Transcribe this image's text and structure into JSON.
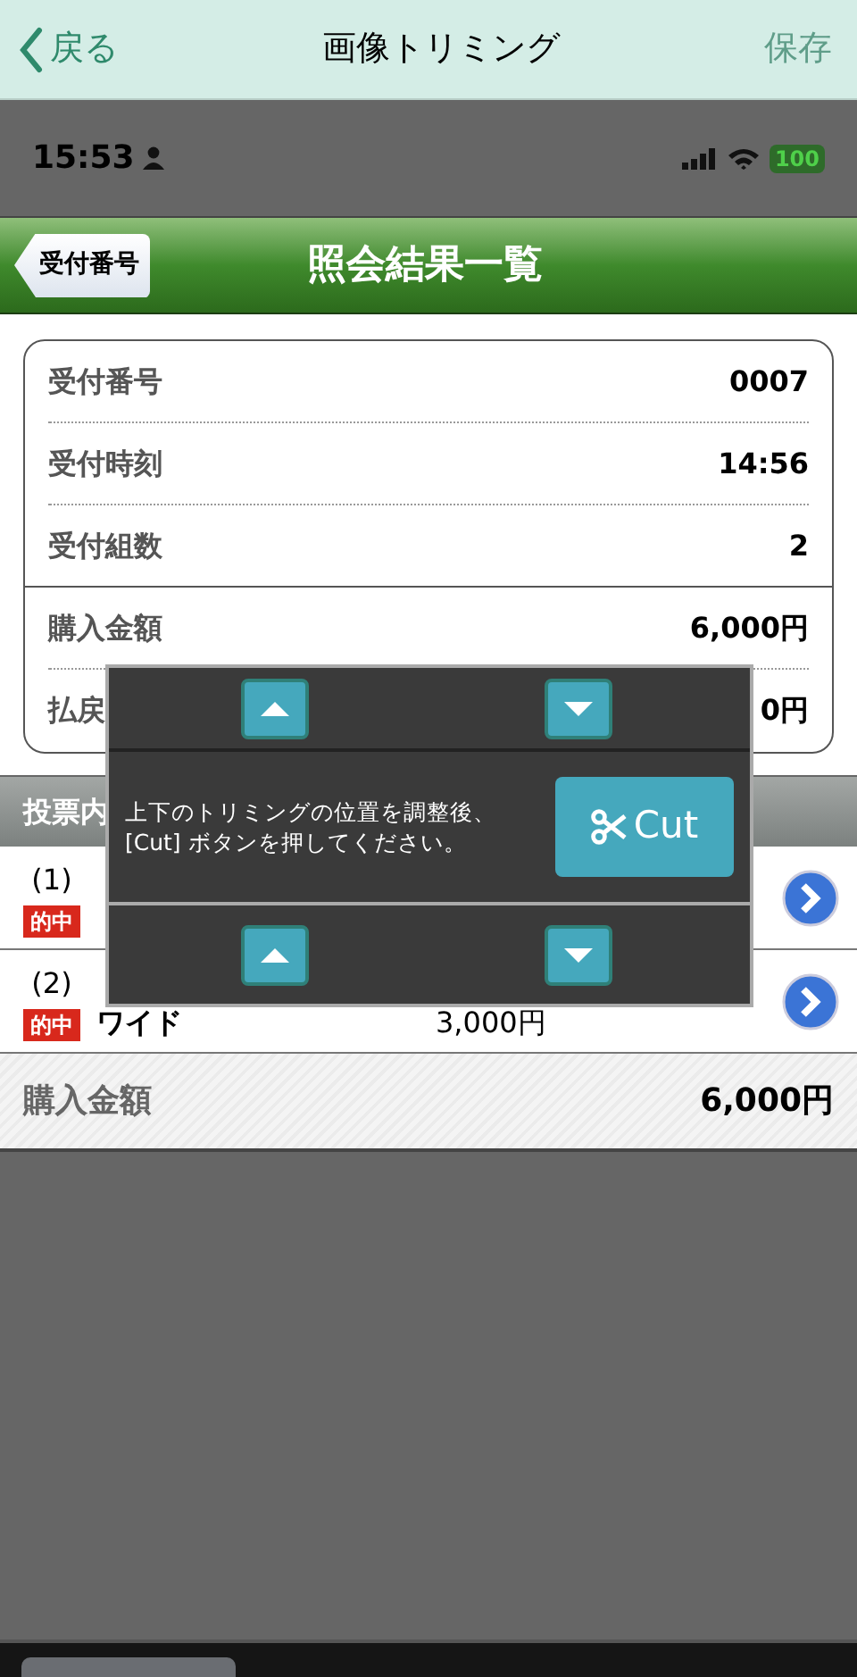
{
  "nav": {
    "back": "戻る",
    "title": "画像トリミング",
    "save": "保存",
    "save_disabled": true
  },
  "status_bar": {
    "time": "15:53",
    "battery": "100"
  },
  "header": {
    "back": "受付番号",
    "title": "照会結果一覧"
  },
  "summary": [
    {
      "label": "受付番号",
      "value": "0007"
    },
    {
      "label": "受付時刻",
      "value": "14:56"
    },
    {
      "label": "受付組数",
      "value": "2"
    },
    {
      "label": "購入金額",
      "value": "6,000円"
    },
    {
      "label": "払戻",
      "value": "0円"
    }
  ],
  "section": {
    "title": "投票内"
  },
  "bets": [
    {
      "index": "(1)",
      "badge": "的中"
    },
    {
      "index": "(2)",
      "badge": "的中",
      "type": "ワイド",
      "amount": "3,000円"
    }
  ],
  "total": {
    "label": "購入金額",
    "value": "6,000円"
  },
  "trim_overlay": {
    "instruction": "上下のトリミングの位置を調整後、[Cut] ボタンを押してください。",
    "cut_button": "Cut"
  }
}
